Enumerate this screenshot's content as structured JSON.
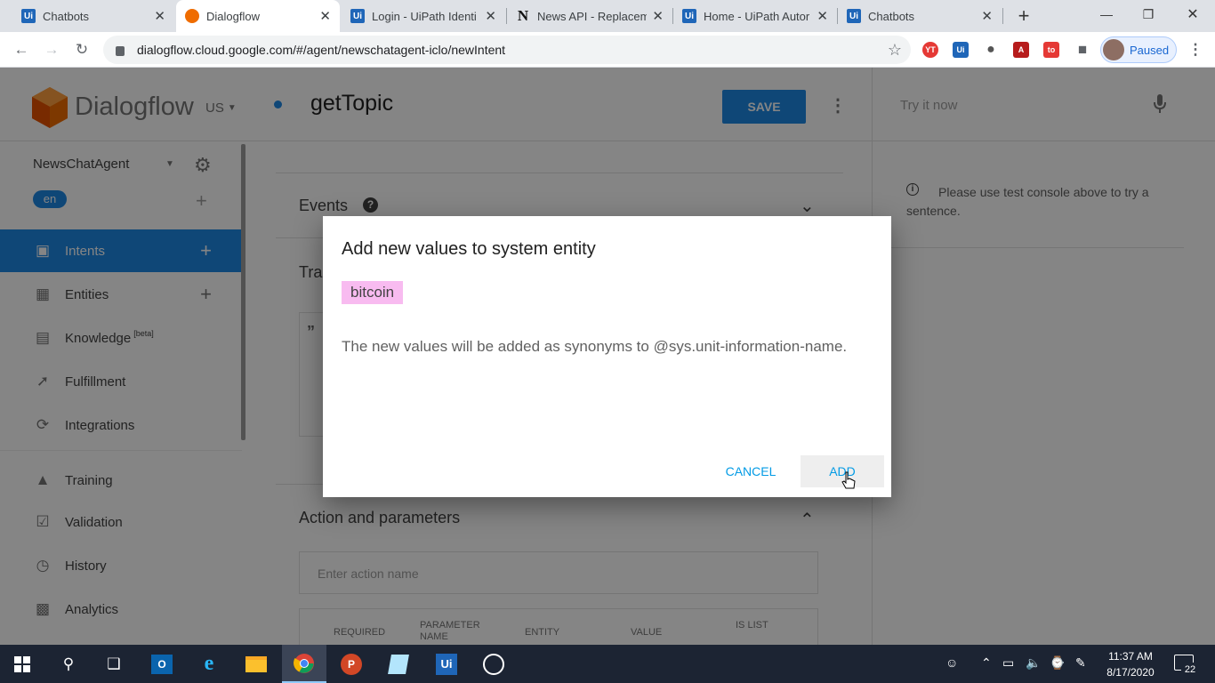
{
  "browser": {
    "tabs": [
      {
        "title": "Chatbots",
        "icon": "uipath-icon"
      },
      {
        "title": "Dialogflow",
        "icon": "dialogflow-icon"
      },
      {
        "title": "Login - UiPath Identi",
        "icon": "uipath-icon"
      },
      {
        "title": "News API - Replacem",
        "icon": "notion-icon"
      },
      {
        "title": "Home - UiPath Autor",
        "icon": "uipath-icon"
      },
      {
        "title": "Chatbots",
        "icon": "uipath-icon"
      }
    ],
    "url": "dialogflow.cloud.google.com/#/agent/newschatagent-iclo/newIntent",
    "profile_label": "Paused",
    "extensions": [
      "YT",
      "Ui",
      "●",
      "A",
      "to"
    ]
  },
  "app": {
    "brand": "Dialogflow",
    "region": "US",
    "agent_name": "NewsChatAgent",
    "language": "en",
    "nav": [
      {
        "label": "Intents",
        "has_add": true
      },
      {
        "label": "Entities",
        "has_add": true
      },
      {
        "label": "Knowledge",
        "sup": "[beta]"
      },
      {
        "label": "Fulfillment"
      },
      {
        "label": "Integrations"
      },
      {
        "label": "Training"
      },
      {
        "label": "Validation"
      },
      {
        "label": "History"
      },
      {
        "label": "Analytics"
      }
    ]
  },
  "intent": {
    "name": "getTopic",
    "save_label": "SAVE",
    "events_label": "Events",
    "training_label": "Tra",
    "action_section": "Action and parameters",
    "action_placeholder": "Enter action name",
    "table_headers": [
      "REQUIRED",
      "PARAMETER NAME",
      "ENTITY",
      "VALUE",
      "IS LIST"
    ]
  },
  "test_console": {
    "placeholder": "Try it now",
    "hint": "Please use test console above to try a sentence."
  },
  "dialog": {
    "title": "Add new values to system entity",
    "chip": "bitcoin",
    "message": "The new values will be added as synonyms to @sys.unit-information-name.",
    "cancel_label": "CANCEL",
    "add_label": "ADD"
  },
  "taskbar": {
    "time": "11:37 AM",
    "date": "8/17/2020",
    "notification_count": "22"
  },
  "colors": {
    "accent": "#1e88e5",
    "chip_bg": "#f8bbf0",
    "dialog_button": "#039be5"
  }
}
